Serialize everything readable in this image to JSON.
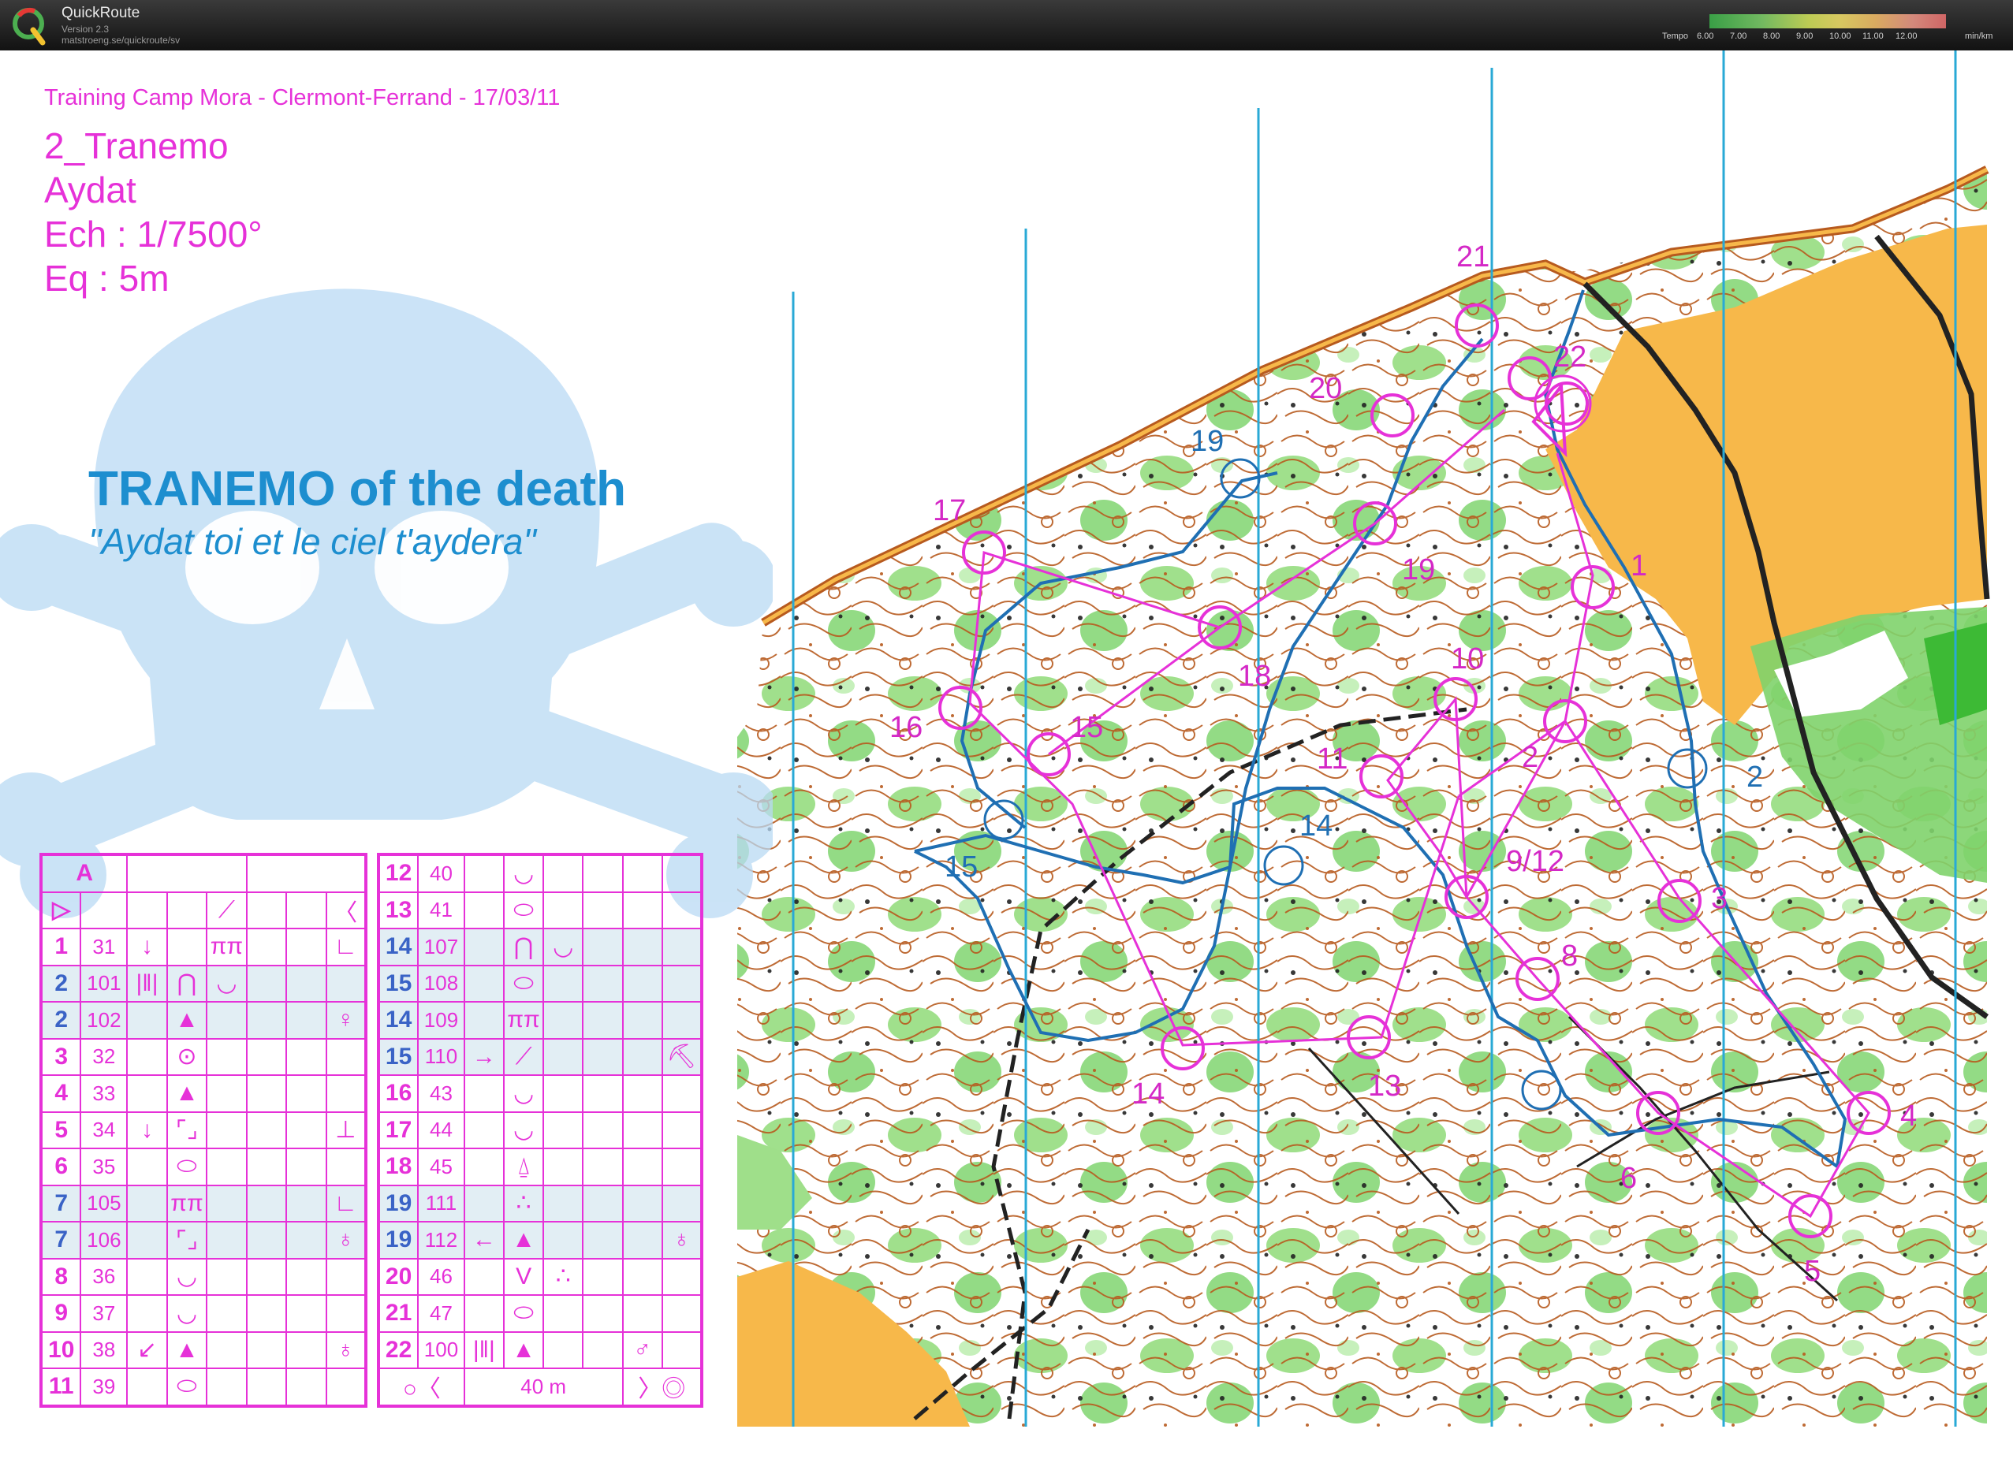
{
  "app": {
    "name": "QuickRoute",
    "version": "Version 2.3",
    "url": "matstroeng.se/quickroute/sv",
    "logo_letter": "Q",
    "pace_legend": {
      "label": "Tempo",
      "ticks": [
        "6.00",
        "7.00",
        "8.00",
        "9.00",
        "10.00",
        "11.00",
        "12.00"
      ],
      "unit": "min/km"
    }
  },
  "header": {
    "event": "Training Camp Mora - Clermont-Ferrand - 17/03/11",
    "course": "2_Tranemo",
    "area": "Aydat",
    "scale": "Ech : 1/7500°",
    "equidistance": "Eq : 5m"
  },
  "tagline": {
    "title": "TRANEMO of the death",
    "subtitle": "\"Aydat toi et le ciel t'aydera\""
  },
  "control_descriptions": {
    "left": {
      "header": "A",
      "rows": [
        {
          "n": "▷",
          "code": "",
          "c": "",
          "d": "",
          "e": "⟋",
          "f": "",
          "g": "",
          "h": "〈",
          "hl": false
        },
        {
          "n": "1",
          "code": "31",
          "c": "↓",
          "d": "",
          "e": "ππ",
          "f": "",
          "g": "",
          "h": "∟",
          "hl": false
        },
        {
          "n": "2",
          "code": "101",
          "c": "|‖|",
          "d": "⋂",
          "e": "◡",
          "f": "",
          "g": "",
          "h": "",
          "hl": true
        },
        {
          "n": "2",
          "code": "102",
          "c": "",
          "d": "▲",
          "e": "",
          "f": "",
          "g": "",
          "h": "♀",
          "hl": true
        },
        {
          "n": "3",
          "code": "32",
          "c": "",
          "d": "⊙",
          "e": "",
          "f": "",
          "g": "",
          "h": "",
          "hl": false
        },
        {
          "n": "4",
          "code": "33",
          "c": "",
          "d": "▲",
          "e": "",
          "f": "",
          "g": "",
          "h": "",
          "hl": false
        },
        {
          "n": "5",
          "code": "34",
          "c": "↓",
          "d": "⌜⌟",
          "e": "",
          "f": "",
          "g": "",
          "h": "⊥",
          "hl": false
        },
        {
          "n": "6",
          "code": "35",
          "c": "",
          "d": "⬭",
          "e": "",
          "f": "",
          "g": "",
          "h": "",
          "hl": false
        },
        {
          "n": "7",
          "code": "105",
          "c": "",
          "d": "ππ",
          "e": "",
          "f": "",
          "g": "",
          "h": "∟",
          "hl": true
        },
        {
          "n": "7",
          "code": "106",
          "c": "",
          "d": "⌜⌟",
          "e": "",
          "f": "",
          "g": "",
          "h": "♁",
          "hl": true
        },
        {
          "n": "8",
          "code": "36",
          "c": "",
          "d": "◡",
          "e": "",
          "f": "",
          "g": "",
          "h": "",
          "hl": false
        },
        {
          "n": "9",
          "code": "37",
          "c": "",
          "d": "◡",
          "e": "",
          "f": "",
          "g": "",
          "h": "",
          "hl": false
        },
        {
          "n": "10",
          "code": "38",
          "c": "↙",
          "d": "▲",
          "e": "",
          "f": "",
          "g": "",
          "h": "♁",
          "hl": false
        },
        {
          "n": "11",
          "code": "39",
          "c": "",
          "d": "⬭",
          "e": "",
          "f": "",
          "g": "",
          "h": "",
          "hl": false
        }
      ]
    },
    "right": {
      "rows": [
        {
          "n": "12",
          "code": "40",
          "c": "",
          "d": "◡",
          "e": "",
          "f": "",
          "g": "",
          "h": "",
          "hl": false
        },
        {
          "n": "13",
          "code": "41",
          "c": "",
          "d": "⬭",
          "e": "",
          "f": "",
          "g": "",
          "h": "",
          "hl": false
        },
        {
          "n": "14",
          "code": "107",
          "c": "",
          "d": "⋂",
          "e": "◡",
          "f": "",
          "g": "",
          "h": "",
          "hl": true
        },
        {
          "n": "15",
          "code": "108",
          "c": "",
          "d": "⬭",
          "e": "",
          "f": "",
          "g": "",
          "h": "",
          "hl": true
        },
        {
          "n": "14",
          "code": "109",
          "c": "",
          "d": "ππ",
          "e": "",
          "f": "",
          "g": "",
          "h": "",
          "hl": true
        },
        {
          "n": "15",
          "code": "110",
          "c": "→",
          "d": "⟋",
          "e": "",
          "f": "",
          "g": "",
          "h": "⛏",
          "hl": true
        },
        {
          "n": "16",
          "code": "43",
          "c": "",
          "d": "◡",
          "e": "",
          "f": "",
          "g": "",
          "h": "",
          "hl": false
        },
        {
          "n": "17",
          "code": "44",
          "c": "",
          "d": "◡",
          "e": "",
          "f": "",
          "g": "",
          "h": "",
          "hl": false
        },
        {
          "n": "18",
          "code": "45",
          "c": "",
          "d": "⍙",
          "e": "",
          "f": "",
          "g": "",
          "h": "",
          "hl": false
        },
        {
          "n": "19",
          "code": "111",
          "c": "",
          "d": "∴",
          "e": "",
          "f": "",
          "g": "",
          "h": "",
          "hl": true
        },
        {
          "n": "19",
          "code": "112",
          "c": "←",
          "d": "▲",
          "e": "",
          "f": "",
          "g": "",
          "h": "♁",
          "hl": true
        },
        {
          "n": "20",
          "code": "46",
          "c": "",
          "d": "V",
          "e": "∴",
          "f": "",
          "g": "",
          "h": "",
          "hl": false
        },
        {
          "n": "21",
          "code": "47",
          "c": "",
          "d": "⬭",
          "e": "",
          "f": "",
          "g": "",
          "h": "",
          "hl": false
        },
        {
          "n": "22",
          "code": "100",
          "c": "|‖|",
          "d": "▲",
          "e": "",
          "f": "",
          "g": "♂",
          "h": "",
          "hl": false
        }
      ],
      "footer": {
        "start_symbol": "○〈",
        "distance": "40 m",
        "finish_symbol": "〉◎"
      }
    }
  },
  "map": {
    "colors": {
      "course": "#e631d8",
      "gps_route": "#1f6fb3",
      "meridian": "#29a9d6",
      "open_land": "#f7b84a",
      "forest_green": "#7fd36b",
      "contour": "#b75a1e"
    },
    "control_labels": [
      {
        "id": "c1",
        "text": "1"
      },
      {
        "id": "c2",
        "text": "2"
      },
      {
        "id": "c3",
        "text": "3"
      },
      {
        "id": "c4",
        "text": "4"
      },
      {
        "id": "c5",
        "text": "5"
      },
      {
        "id": "c6",
        "text": "6"
      },
      {
        "id": "c8",
        "text": "8"
      },
      {
        "id": "c912",
        "text": "9/12"
      },
      {
        "id": "c10",
        "text": "10"
      },
      {
        "id": "c11",
        "text": "11"
      },
      {
        "id": "c13",
        "text": "13"
      },
      {
        "id": "c14",
        "text": "14"
      },
      {
        "id": "c15",
        "text": "15"
      },
      {
        "id": "c16",
        "text": "16"
      },
      {
        "id": "c17",
        "text": "17"
      },
      {
        "id": "c18",
        "text": "18"
      },
      {
        "id": "c19",
        "text": "19"
      },
      {
        "id": "c20",
        "text": "20"
      },
      {
        "id": "c21",
        "text": "21"
      },
      {
        "id": "c22",
        "text": "22"
      }
    ],
    "route_labels": [
      {
        "id": "r19",
        "text": "19"
      },
      {
        "id": "r14",
        "text": "14"
      },
      {
        "id": "r15",
        "text": "15"
      },
      {
        "id": "r2",
        "text": "2"
      }
    ]
  }
}
